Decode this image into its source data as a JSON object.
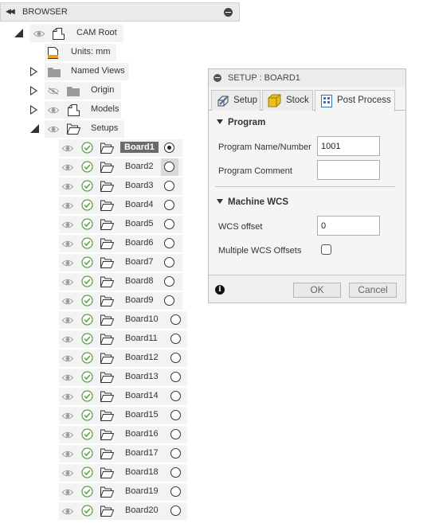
{
  "browser": {
    "collapse_glyph": "◀◀",
    "title": "BROWSER",
    "items": [
      {
        "label": "CAM Root"
      },
      {
        "label": "Units: mm"
      },
      {
        "label": "Named Views"
      },
      {
        "label": "Origin"
      },
      {
        "label": "Models"
      },
      {
        "label": "Setups"
      }
    ],
    "setups": [
      {
        "label": "Board1",
        "selected": true
      },
      {
        "label": "Board2"
      },
      {
        "label": "Board3"
      },
      {
        "label": "Board4"
      },
      {
        "label": "Board5"
      },
      {
        "label": "Board6"
      },
      {
        "label": "Board7"
      },
      {
        "label": "Board8"
      },
      {
        "label": "Board9"
      },
      {
        "label": "Board10"
      },
      {
        "label": "Board11"
      },
      {
        "label": "Board12"
      },
      {
        "label": "Board13"
      },
      {
        "label": "Board14"
      },
      {
        "label": "Board15"
      },
      {
        "label": "Board16"
      },
      {
        "label": "Board17"
      },
      {
        "label": "Board18"
      },
      {
        "label": "Board19"
      },
      {
        "label": "Board20"
      }
    ]
  },
  "dialog": {
    "title": "SETUP : BOARD1",
    "tabs": [
      {
        "label": "Setup"
      },
      {
        "label": "Stock"
      },
      {
        "label": "Post Process",
        "active": true
      }
    ],
    "program": {
      "heading": "Program",
      "name_label": "Program Name/Number",
      "name_value": "1001",
      "comment_label": "Program Comment",
      "comment_value": ""
    },
    "machine_wcs": {
      "heading": "Machine WCS",
      "offset_label": "WCS offset",
      "offset_value": "0",
      "multiple_label": "Multiple WCS Offsets",
      "multiple_checked": false
    },
    "ok_label": "OK",
    "cancel_label": "Cancel",
    "info_glyph": "i"
  },
  "colors": {
    "check": "#5aa33a",
    "row_bg": "#f3f3f3",
    "selected_label_bg": "#6b6b6b",
    "stock_icon": "#e8c020",
    "post_icon": "#3b6fb6"
  },
  "icons": [
    "eye-icon",
    "eye-hidden-icon",
    "folder-icon",
    "open-folder-icon",
    "doc-icon",
    "ruler-icon",
    "check-circle-icon",
    "radio-icon",
    "setup-tab-icon",
    "stock-cube-icon",
    "post-process-icon",
    "info-icon",
    "minimize-icon",
    "collapse-icon",
    "expand-triangle-icon"
  ]
}
